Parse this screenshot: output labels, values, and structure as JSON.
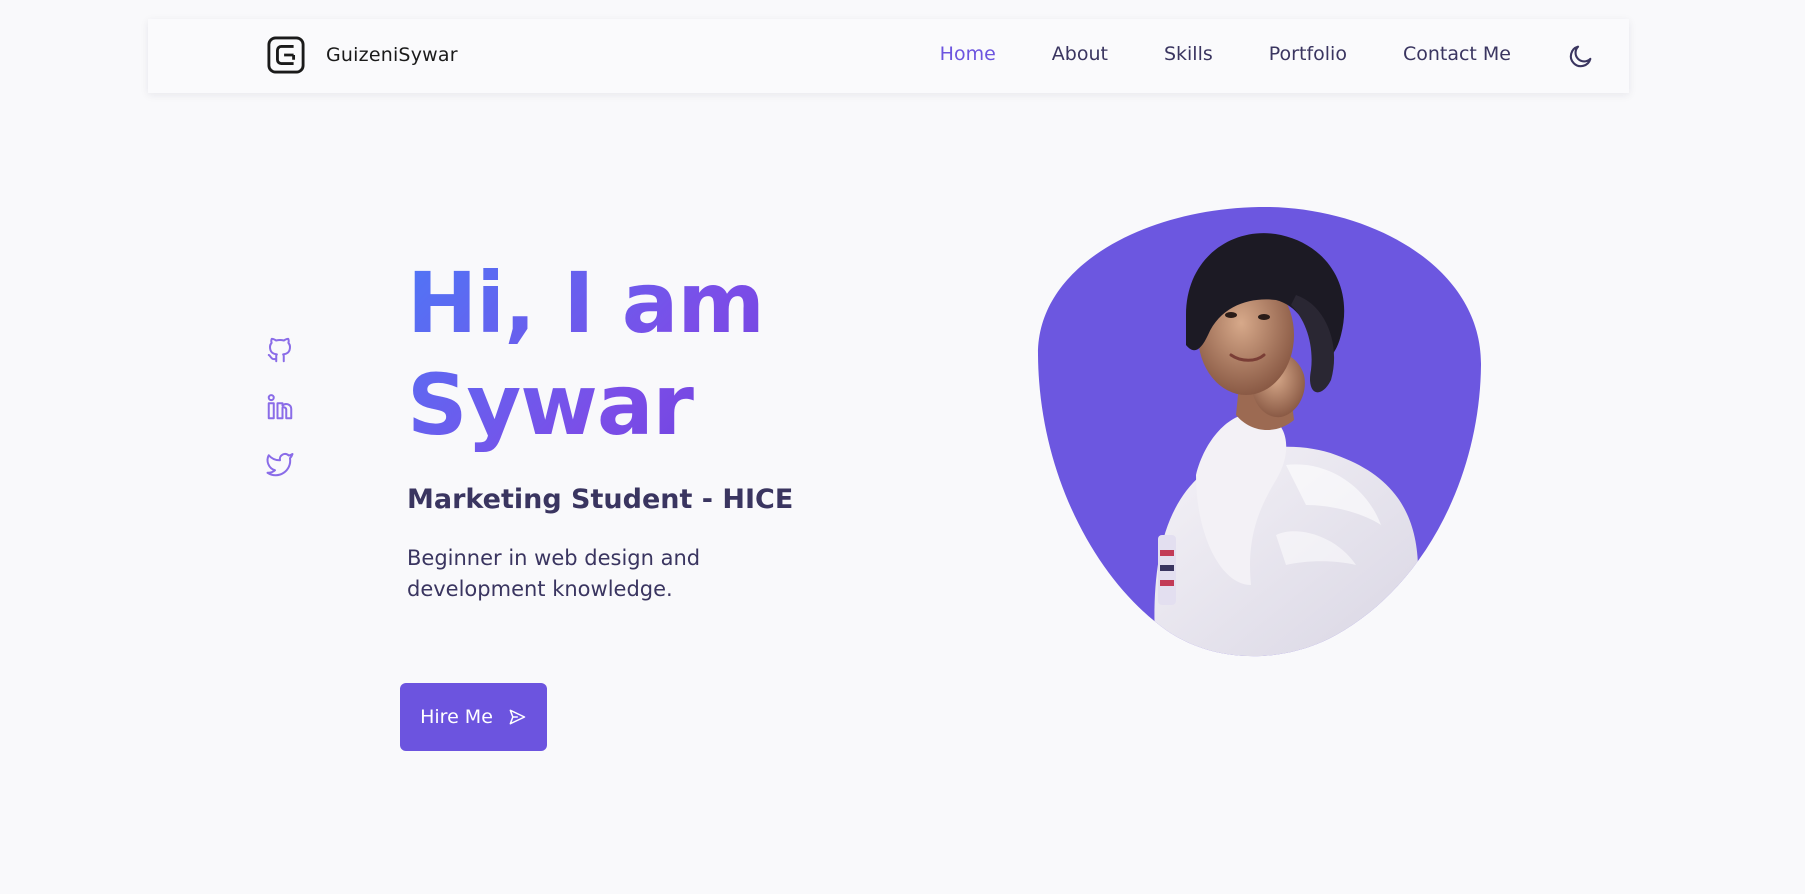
{
  "header": {
    "logo_name": "GuizeniSywar",
    "nav": [
      {
        "label": "Home",
        "active": true
      },
      {
        "label": "About",
        "active": false
      },
      {
        "label": "Skills",
        "active": false
      },
      {
        "label": "Portfolio",
        "active": false
      },
      {
        "label": "Contact Me",
        "active": false
      }
    ],
    "theme_icon": "moon-icon"
  },
  "social": [
    {
      "name": "github-icon"
    },
    {
      "name": "linkedin-icon"
    },
    {
      "name": "twitter-icon"
    }
  ],
  "hero": {
    "title_line1": "Hi, I am",
    "title_line2": "Sywar",
    "subtitle": "Marketing Student - HICE",
    "description": "Beginner in web design and development knowledge.",
    "button_label": "Hire Me",
    "button_icon": "send-icon",
    "profile_image": "profile-photo"
  },
  "colors": {
    "accent": "#6c54df",
    "text": "#3a3560",
    "background": "#f9f9fb",
    "gradient_start": "#4f76f6",
    "gradient_end": "#6b3bd8"
  }
}
